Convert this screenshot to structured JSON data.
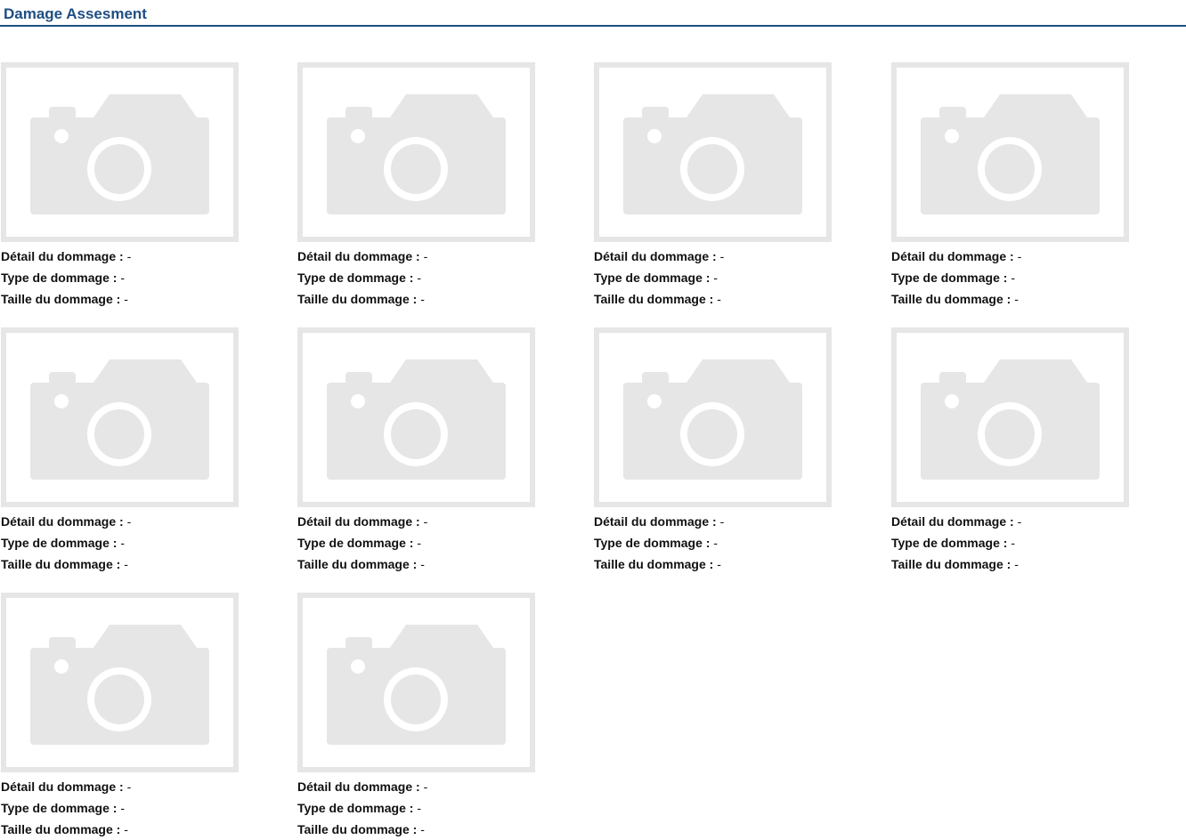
{
  "header": {
    "title": "Damage Assesment",
    "accent_color": "#1f4e83"
  },
  "placeholder": {
    "icon": "camera-icon",
    "color": "#e6e6e6"
  },
  "damages": [
    {
      "detail_label": "Détail du dommage :",
      "detail_value": "-",
      "type_label": "Type de dommage :",
      "type_value": "-",
      "size_label": "Taille du dommage :",
      "size_value": "-"
    },
    {
      "detail_label": "Détail du dommage :",
      "detail_value": "-",
      "type_label": "Type de dommage :",
      "type_value": "-",
      "size_label": "Taille du dommage :",
      "size_value": "-"
    },
    {
      "detail_label": "Détail du dommage :",
      "detail_value": "-",
      "type_label": "Type de dommage :",
      "type_value": "-",
      "size_label": "Taille du dommage :",
      "size_value": "-"
    },
    {
      "detail_label": "Détail du dommage :",
      "detail_value": "-",
      "type_label": "Type de dommage :",
      "type_value": "-",
      "size_label": "Taille du dommage :",
      "size_value": "-"
    },
    {
      "detail_label": "Détail du dommage :",
      "detail_value": "-",
      "type_label": "Type de dommage :",
      "type_value": "-",
      "size_label": "Taille du dommage :",
      "size_value": "-"
    },
    {
      "detail_label": "Détail du dommage :",
      "detail_value": "-",
      "type_label": "Type de dommage :",
      "type_value": "-",
      "size_label": "Taille du dommage :",
      "size_value": "-"
    },
    {
      "detail_label": "Détail du dommage :",
      "detail_value": "-",
      "type_label": "Type de dommage :",
      "type_value": "-",
      "size_label": "Taille du dommage :",
      "size_value": "-"
    },
    {
      "detail_label": "Détail du dommage :",
      "detail_value": "-",
      "type_label": "Type de dommage :",
      "type_value": "-",
      "size_label": "Taille du dommage :",
      "size_value": "-"
    },
    {
      "detail_label": "Détail du dommage :",
      "detail_value": "-",
      "type_label": "Type de dommage :",
      "type_value": "-",
      "size_label": "Taille du dommage :",
      "size_value": "-"
    },
    {
      "detail_label": "Détail du dommage :",
      "detail_value": "-",
      "type_label": "Type de dommage :",
      "type_value": "-",
      "size_label": "Taille du dommage :",
      "size_value": "-"
    }
  ]
}
